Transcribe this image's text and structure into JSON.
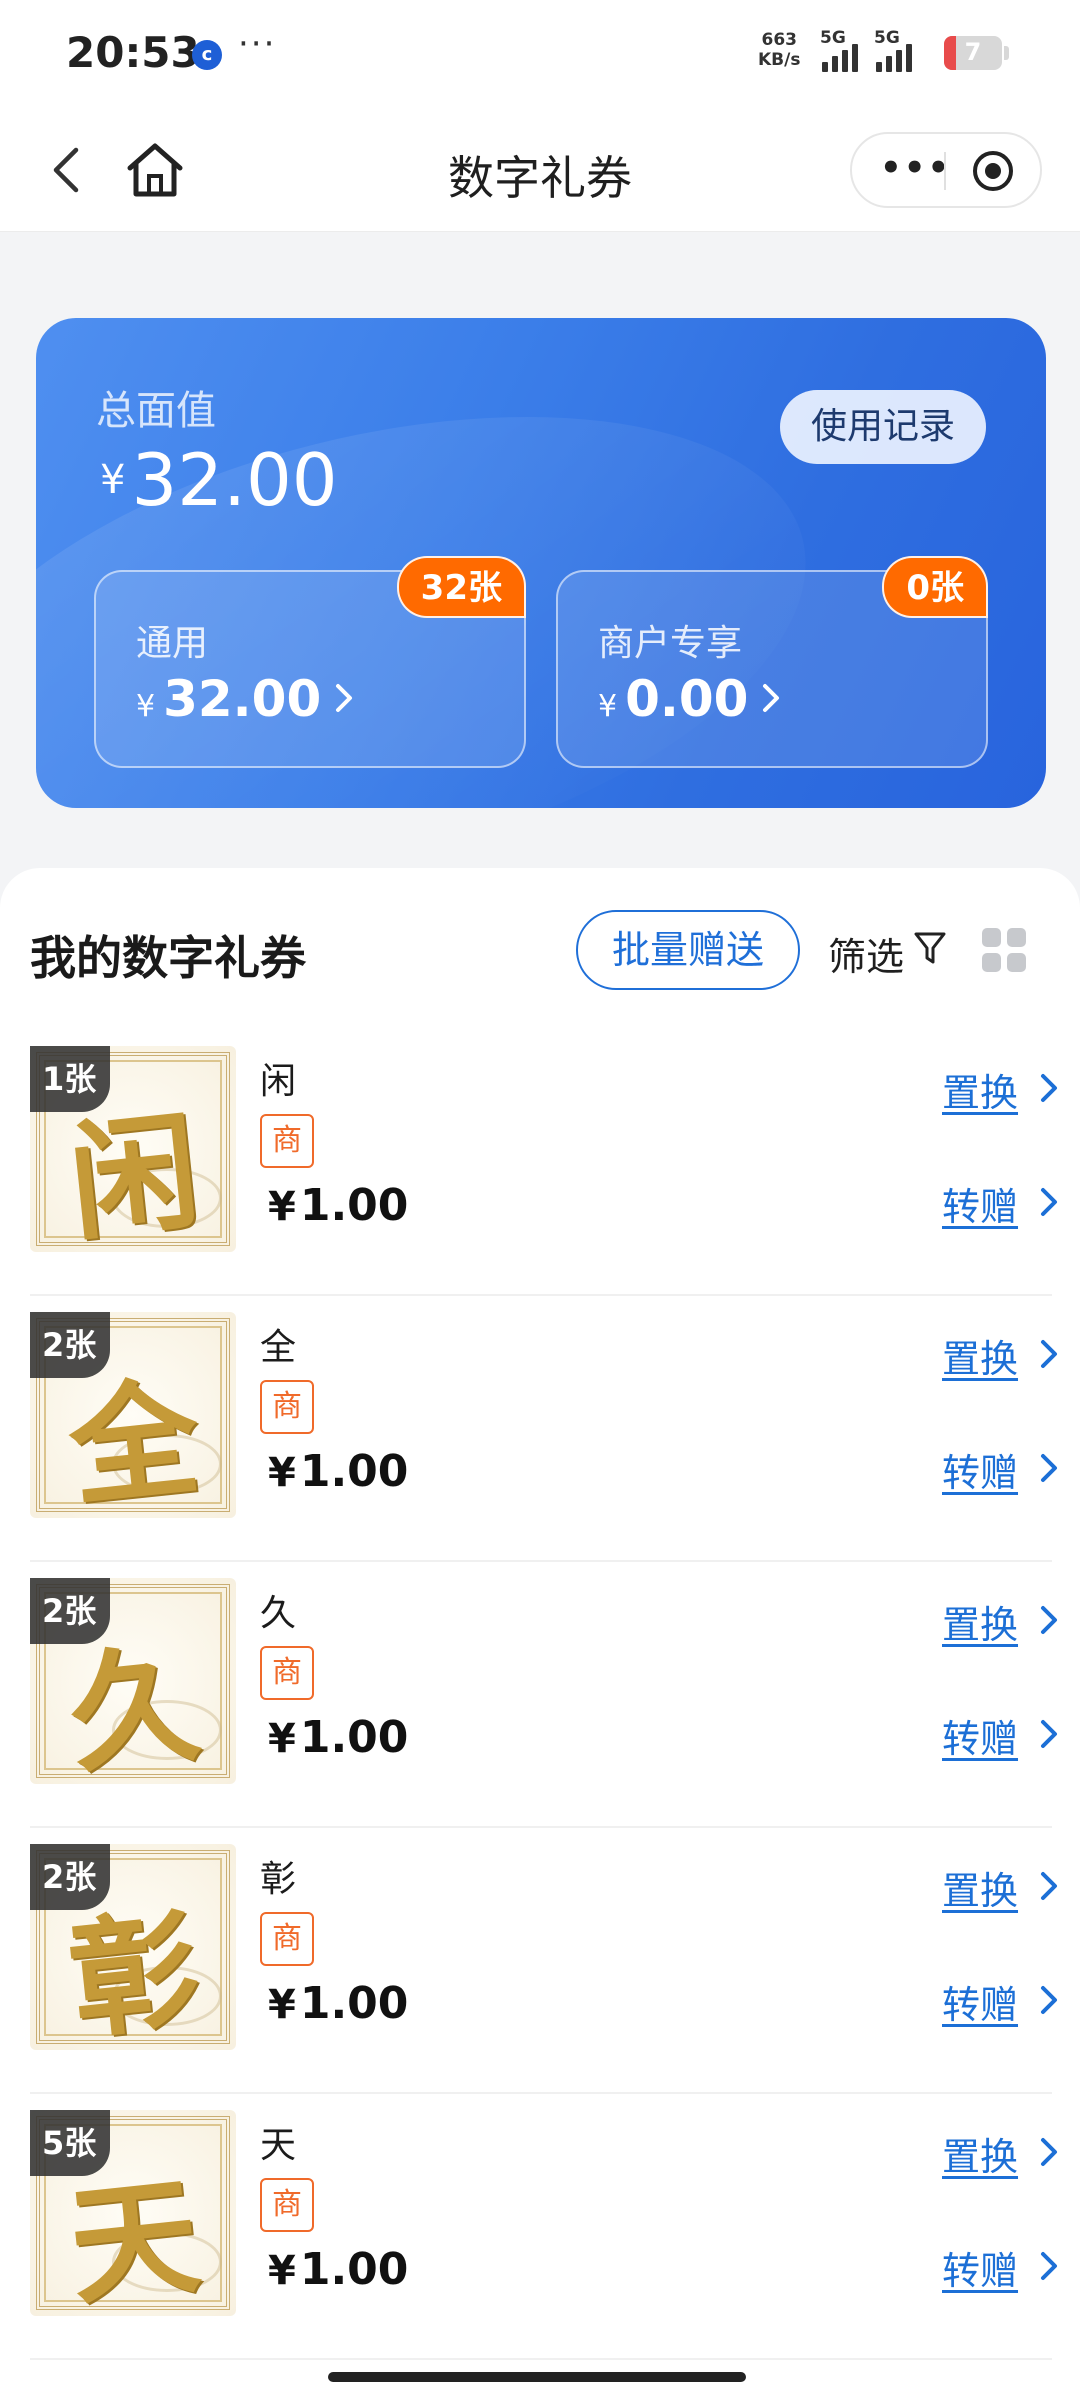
{
  "status_bar": {
    "time": "20:53",
    "app_icon": "c",
    "more": "···",
    "net_speed_value": "663",
    "net_speed_unit": "KB/s",
    "signal1_label": "5G",
    "signal2_label": "5G",
    "battery_level": "7",
    "battery_color": "#e84b4b"
  },
  "nav": {
    "title": "数字礼券",
    "more_label": "•••"
  },
  "summary": {
    "total_label": "总面值",
    "currency": "¥",
    "total_amount": "32.00",
    "usage_button": "使用记录",
    "general": {
      "label": "通用",
      "amount": "32.00",
      "count": "32张"
    },
    "merchant": {
      "label": "商户专享",
      "amount": "0.00",
      "count": "0张"
    }
  },
  "list": {
    "title": "我的数字礼券",
    "batch_gift_button": "批量赠送",
    "filter_label": "筛选",
    "merchant_tag": "商",
    "swap_label": "置换",
    "gift_label": "转赠",
    "accent_color": "#1c6fd6",
    "items": [
      {
        "char": "闲",
        "name": "闲",
        "qty": "1张",
        "price": "1.00"
      },
      {
        "char": "全",
        "name": "全",
        "qty": "2张",
        "price": "1.00"
      },
      {
        "char": "久",
        "name": "久",
        "qty": "2张",
        "price": "1.00"
      },
      {
        "char": "彰",
        "name": "彰",
        "qty": "2张",
        "price": "1.00"
      },
      {
        "char": "天",
        "name": "天",
        "qty": "5张",
        "price": "1.00"
      }
    ]
  }
}
